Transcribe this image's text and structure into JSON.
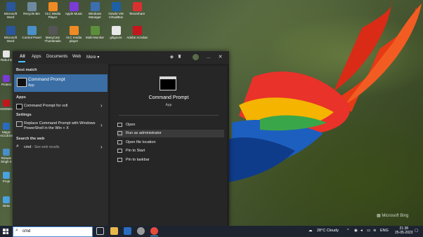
{
  "desktop": {
    "icons": [
      {
        "label": "Microsoft Word",
        "color": "#2b579a"
      },
      {
        "label": "Recycle Bin",
        "color": "#6f8aa0"
      },
      {
        "label": "VLC Media Player",
        "color": "#f08a24"
      },
      {
        "label": "Apple Music",
        "color": "#7a3bd6"
      },
      {
        "label": "Windows Manager",
        "color": "#3c6fb0"
      },
      {
        "label": "Oracle VM VirtualBox",
        "color": "#1f5fa6"
      },
      {
        "label": "Tenorshare",
        "color": "#d93030"
      },
      {
        "label": "Microsoft Word",
        "color": "#2b579a"
      },
      {
        "label": "Control Panel",
        "color": "#4b8fc7"
      },
      {
        "label": "ManyCam Thumbnails",
        "color": "#555555"
      },
      {
        "label": "VLC media player",
        "color": "#f08a24"
      },
      {
        "label": "Multi-Monitor",
        "color": "#5c8f3b"
      },
      {
        "label": "gitignore",
        "color": "#e8e8e8"
      },
      {
        "label": "Adobe Acrobat",
        "color": "#c4161c"
      }
    ],
    "left_column": [
      "Rahul B",
      "Protect",
      "KNOWN",
      "Magic ACCESS",
      "Rizwan Singh K",
      "Proje",
      "Netw"
    ],
    "watermark": "Microsoft Bing"
  },
  "panel": {
    "tabs": [
      "All",
      "Apps",
      "Documents",
      "Web",
      "More ▾"
    ],
    "header_icons": [
      "…",
      "✕"
    ],
    "best_match_heading": "Best match",
    "best_match": {
      "name": "Command Prompt",
      "type": "App"
    },
    "apps_heading": "Apps",
    "apps": [
      {
        "label": "Command Prompt for vctl"
      }
    ],
    "settings_heading": "Settings",
    "settings": [
      {
        "label": "Replace Command Prompt with Windows PowerShell in the Win + X"
      }
    ],
    "web_heading": "Search the web",
    "web": [
      {
        "query": "cmd",
        "suffix": "- See web results"
      }
    ],
    "preview": {
      "name": "Command Prompt",
      "type": "App",
      "actions": [
        "Open",
        "Run as administrator",
        "Open file location",
        "Pin to Start",
        "Pin to taskbar"
      ],
      "highlighted": "Run as administrator"
    }
  },
  "taskbar": {
    "search_value": "cmd",
    "weather": "28°C  Cloudy",
    "language": "ENG",
    "time": "21:38",
    "date": "25-05-2023"
  }
}
